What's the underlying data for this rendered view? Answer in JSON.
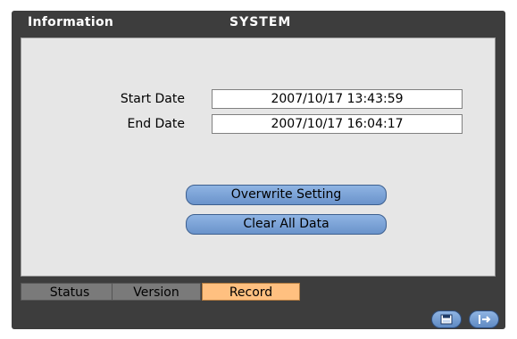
{
  "window": {
    "title": "Information",
    "section_title": "SYSTEM"
  },
  "record": {
    "start_label": "Start Date",
    "start_value": "2007/10/17  13:43:59",
    "end_label": "End Date",
    "end_value": "2007/10/17  16:04:17",
    "overwrite_button": "Overwrite Setting",
    "clear_button": "Clear All Data"
  },
  "tabs": [
    {
      "label": "Status",
      "active": false
    },
    {
      "label": "Version",
      "active": false
    },
    {
      "label": "Record",
      "active": true
    }
  ],
  "footer": {
    "save_icon": "save-icon",
    "exit_icon": "exit-icon"
  },
  "colors": {
    "frame": "#3d3d3d",
    "panel": "#e6e6e6",
    "active_tab": "#ffc080",
    "button_blue": "#7aa3d8"
  }
}
